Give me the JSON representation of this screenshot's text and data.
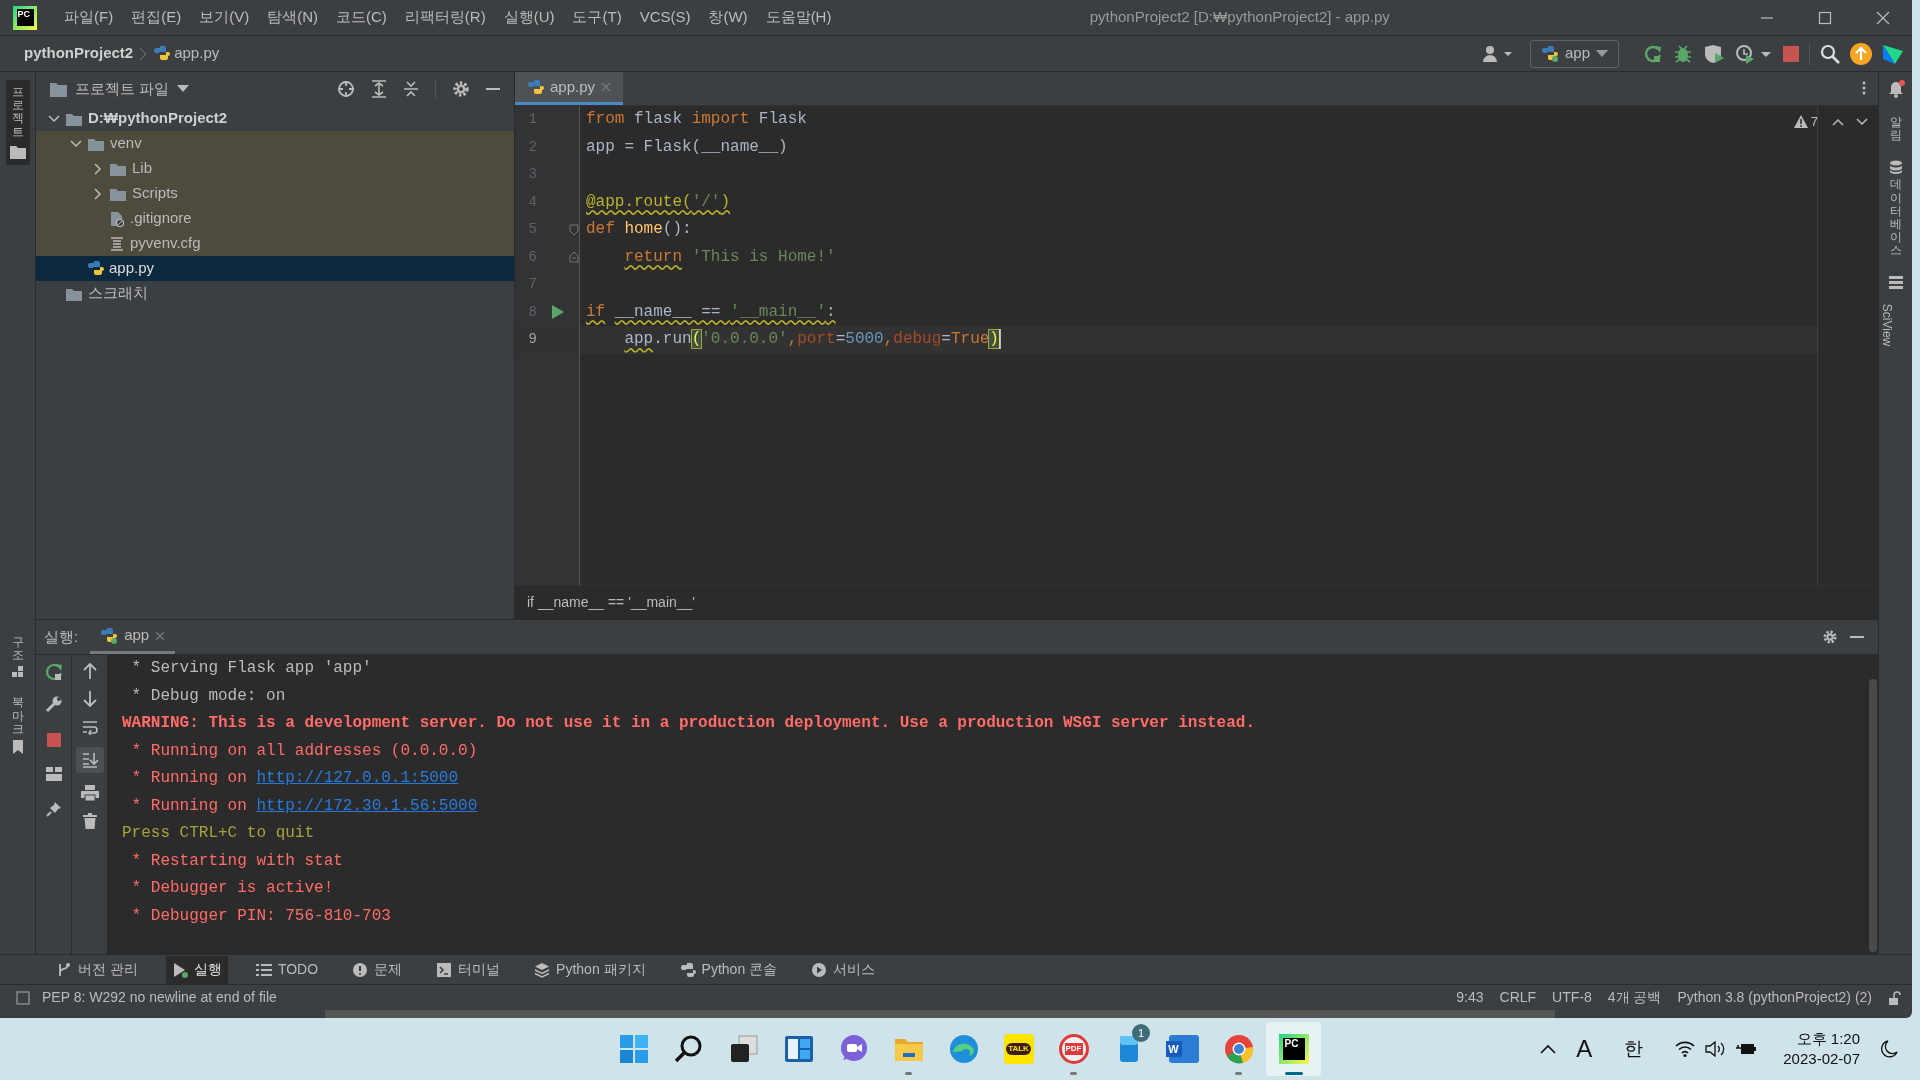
{
  "window": {
    "logo": "PC",
    "title": "pythonProject2 [D:₩pythonProject2] - app.py"
  },
  "menu": [
    "파일(F)",
    "편집(E)",
    "보기(V)",
    "탐색(N)",
    "코드(C)",
    "리팩터링(R)",
    "실행(U)",
    "도구(T)",
    "VCS(S)",
    "창(W)",
    "도움말(H)"
  ],
  "breadcrumb": {
    "project": "pythonProject2",
    "file": "app.py"
  },
  "run_config": {
    "label": "app"
  },
  "left_stripe": [
    "프로젝트",
    "구조",
    "북마크"
  ],
  "right_stripe": [
    {
      "label": "알림",
      "kind": "korean"
    },
    {
      "label": "데이터베이스",
      "kind": "korean"
    },
    {
      "label": "SciView",
      "kind": "latin"
    }
  ],
  "project_panel": {
    "title": "프로젝트 파일",
    "tree": [
      {
        "label": "D:₩pythonProject2",
        "kind": "folder",
        "expanded": true,
        "selected": false,
        "excluded": false,
        "children": [
          {
            "label": "venv",
            "kind": "folder",
            "expanded": true,
            "selected": false,
            "excluded": true,
            "children": [
              {
                "label": "Lib",
                "kind": "folder",
                "expanded": false,
                "selected": false,
                "excluded": true
              },
              {
                "label": "Scripts",
                "kind": "folder",
                "expanded": false,
                "selected": false,
                "excluded": true
              },
              {
                "label": ".gitignore",
                "kind": "ignore-file",
                "selected": false,
                "excluded": true
              },
              {
                "label": "pyvenv.cfg",
                "kind": "config-file",
                "selected": false,
                "excluded": true
              }
            ]
          },
          {
            "label": "app.py",
            "kind": "python-file",
            "selected": true,
            "excluded": false
          }
        ]
      },
      {
        "label": "스크래치",
        "kind": "scratch",
        "selected": false,
        "excluded": false
      }
    ]
  },
  "editor": {
    "tabs": [
      {
        "label": "app.py",
        "selected": true
      }
    ],
    "warnings": "7",
    "lines": [
      {
        "number": "1",
        "current": false,
        "runnable": false,
        "tokens": [
          {
            "text": "from",
            "kind": "kw",
            "warning": false
          },
          {
            "text": " flask ",
            "kind": "plain",
            "warning": false
          },
          {
            "text": "import",
            "kind": "kw",
            "warning": false
          },
          {
            "text": " Flask",
            "kind": "plain",
            "warning": false
          }
        ]
      },
      {
        "number": "2",
        "current": false,
        "runnable": false,
        "tokens": [
          {
            "text": "app = Flask(__name__)",
            "kind": "plain",
            "warning": false
          }
        ]
      },
      {
        "number": "3",
        "current": false,
        "runnable": false
      },
      {
        "number": "4",
        "current": false,
        "runnable": false,
        "tokens": [
          {
            "text": "@app.route(",
            "kind": "deco",
            "warning": true
          },
          {
            "text": "'/'",
            "kind": "str",
            "warning": true
          },
          {
            "text": ")",
            "kind": "deco",
            "warning": true
          }
        ]
      },
      {
        "number": "5",
        "current": false,
        "runnable": false,
        "kind": "fold-start",
        "tokens": [
          {
            "text": "def ",
            "kind": "kw",
            "warning": false
          },
          {
            "text": "home",
            "kind": "func",
            "warning": false
          },
          {
            "text": "():",
            "kind": "plain",
            "warning": false
          }
        ]
      },
      {
        "number": "6",
        "current": false,
        "runnable": false,
        "kind": "fold-end",
        "tokens": [
          {
            "text": "    return",
            "kind": "kw",
            "warning": true
          },
          {
            "text": " 'This is Home!'",
            "kind": "str",
            "warning": false
          }
        ]
      },
      {
        "number": "7",
        "current": false,
        "runnable": false
      },
      {
        "number": "8",
        "current": false,
        "runnable": true,
        "tokens": [
          {
            "text": "if",
            "kind": "kw",
            "warning": true
          },
          {
            "text": " __name__ == ",
            "kind": "plain",
            "warning": true
          },
          {
            "text": "'__main__'",
            "kind": "str",
            "warning": true
          },
          {
            "text": ":",
            "kind": "plain",
            "warning": true
          }
        ]
      },
      {
        "number": "9",
        "current": true,
        "runnable": false,
        "tokens": [
          {
            "text": "    app",
            "kind": "plain",
            "warning": true
          },
          {
            "text": ".run",
            "kind": "plain",
            "warning": false
          },
          {
            "text": "(",
            "kind": "brace",
            "warning": false
          },
          {
            "text": "'0.0.0.0'",
            "kind": "str",
            "warning": false
          },
          {
            "text": ",",
            "kind": "kw",
            "warning": false
          },
          {
            "text": "port",
            "kind": "param",
            "warning": false
          },
          {
            "text": "=",
            "kind": "plain",
            "warning": false
          },
          {
            "text": "5000",
            "kind": "num",
            "warning": false
          },
          {
            "text": ",",
            "kind": "kw",
            "warning": false
          },
          {
            "text": "debug",
            "kind": "param",
            "warning": false
          },
          {
            "text": "=",
            "kind": "plain",
            "warning": false
          },
          {
            "text": "True",
            "kind": "kw",
            "warning": false
          },
          {
            "text": ")",
            "kind": "brace",
            "warning": false
          }
        ]
      }
    ],
    "breadcrumb": "if __name__ == '__main__'"
  },
  "run_panel": {
    "label": "실행:",
    "tabs": [
      {
        "label": "app",
        "selected": true
      }
    ],
    "console": [
      {
        "segments": [
          {
            "text": " * Serving Flask app 'app'",
            "kind": "plain"
          }
        ]
      },
      {
        "segments": [
          {
            "text": " * Debug mode: on",
            "kind": "plain"
          }
        ]
      },
      {
        "segments": [
          {
            "text": "WARNING: This is a development server. Do not use it in a production deployment. Use a production WSGI server instead.",
            "kind": "warning"
          }
        ]
      },
      {
        "segments": [
          {
            "text": " * Running on all addresses (0.0.0.0)",
            "kind": "error"
          }
        ]
      },
      {
        "segments": [
          {
            "text": " * Running on ",
            "kind": "error"
          },
          {
            "text": "http://127.0.0.1:5000",
            "kind": "link"
          }
        ]
      },
      {
        "segments": [
          {
            "text": " * Running on ",
            "kind": "error"
          },
          {
            "text": "http://172.30.1.56:5000",
            "kind": "link"
          }
        ]
      },
      {
        "segments": [
          {
            "text": "Press CTRL+C to quit",
            "kind": "hint"
          }
        ]
      },
      {
        "segments": [
          {
            "text": " * Restarting with stat",
            "kind": "error"
          }
        ]
      },
      {
        "segments": [
          {
            "text": " * Debugger is active!",
            "kind": "error"
          }
        ]
      },
      {
        "segments": [
          {
            "text": " * Debugger PIN: 756-810-703",
            "kind": "error"
          }
        ]
      }
    ]
  },
  "tool_tabs": [
    {
      "label": "버전 관리",
      "kind": "vcs",
      "selected": false
    },
    {
      "label": "실행",
      "kind": "run",
      "selected": true
    },
    {
      "label": "TODO",
      "kind": "todo",
      "selected": false
    },
    {
      "label": "문제",
      "kind": "problems",
      "selected": false
    },
    {
      "label": "터미널",
      "kind": "terminal",
      "selected": false
    },
    {
      "label": "Python 패키지",
      "kind": "packages",
      "selected": false
    },
    {
      "label": "Python 콘솔",
      "kind": "console",
      "selected": false
    },
    {
      "label": "서비스",
      "kind": "services",
      "selected": false
    }
  ],
  "status_bar": {
    "message": "PEP 8: W292 no newline at end of file",
    "items": [
      "9:43",
      "CRLF",
      "UTF-8",
      "4개 공백",
      "Python 3.8 (pythonProject2) (2)"
    ]
  },
  "taskbar": {
    "apps": [
      {
        "kind": "start",
        "running": false,
        "active": false
      },
      {
        "kind": "search",
        "running": false,
        "active": false
      },
      {
        "kind": "taskview",
        "running": false,
        "active": false
      },
      {
        "kind": "widgets",
        "running": false,
        "active": false
      },
      {
        "kind": "meet",
        "running": false,
        "active": false
      },
      {
        "kind": "explorer",
        "running": true,
        "active": false
      },
      {
        "kind": "edge",
        "running": false,
        "active": false
      },
      {
        "kind": "kakao",
        "label": "TALK",
        "running": false,
        "active": false
      },
      {
        "kind": "pdf",
        "label": "PDF",
        "running": true,
        "active": false
      },
      {
        "kind": "phone",
        "badge": "1",
        "running": false,
        "active": false
      },
      {
        "kind": "word",
        "label": "W",
        "running": false,
        "active": false
      },
      {
        "kind": "chrome",
        "running": true,
        "active": false
      },
      {
        "kind": "pycharm",
        "label": "PC",
        "running": true,
        "active": true
      }
    ],
    "tray": {
      "input_mode": "A",
      "ime": "한",
      "time": "오후 1:20",
      "date": "2023-02-07"
    }
  }
}
